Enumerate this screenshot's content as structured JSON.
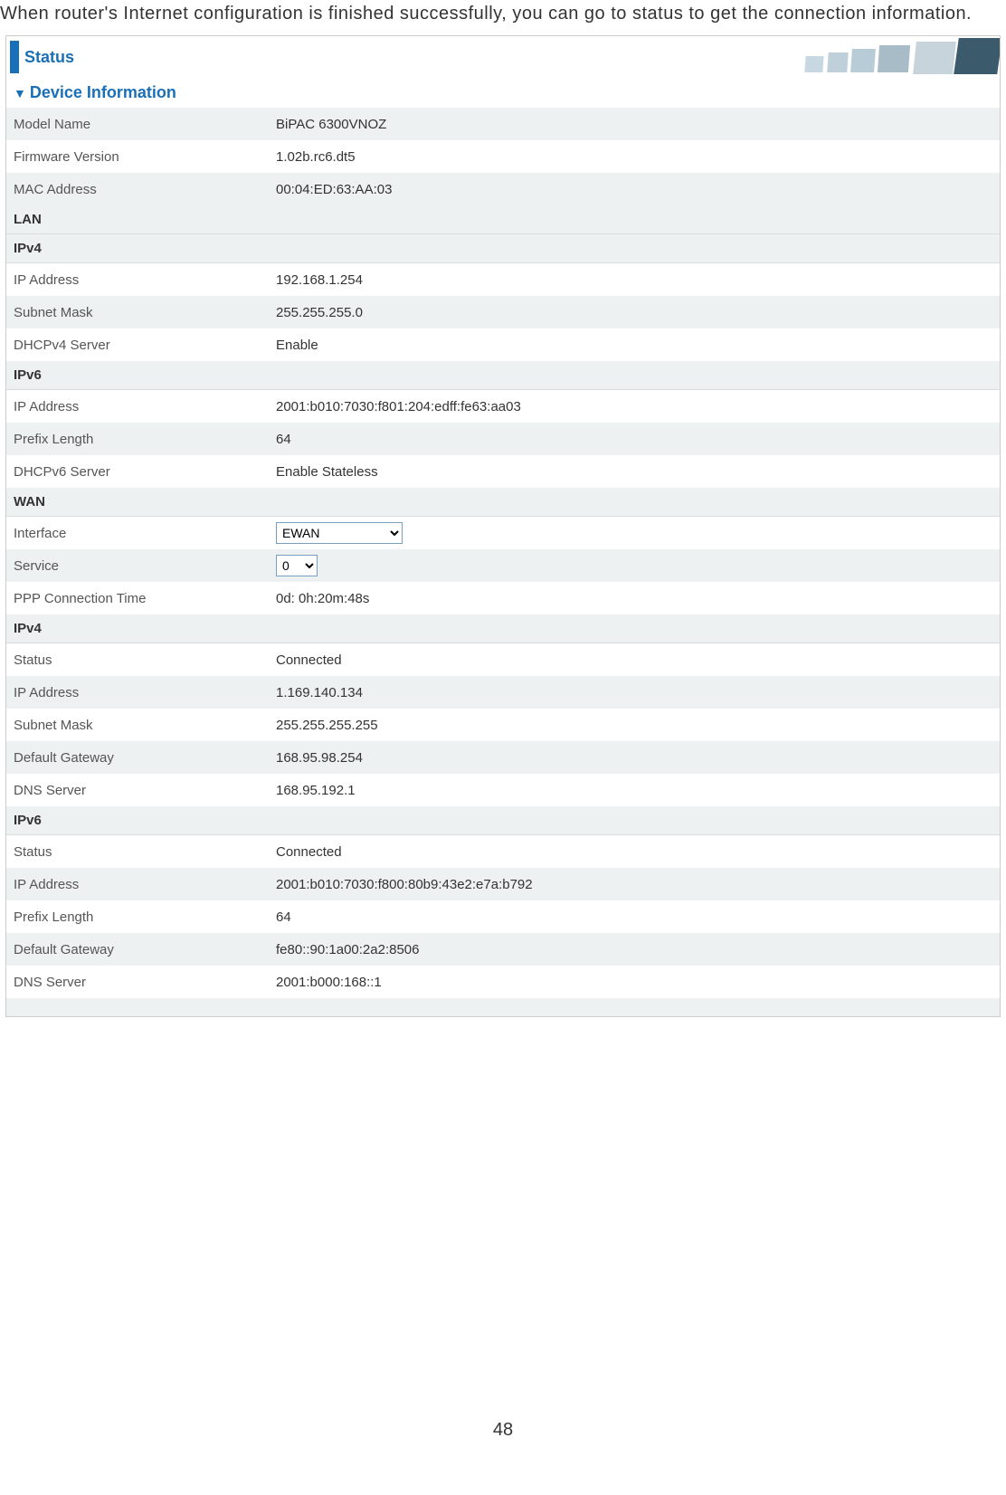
{
  "intro": "When router's Internet configuration is finished successfully, you can go to status to get the connection information.",
  "status_title": "Status",
  "section_title": "Device Information",
  "device": {
    "model_label": "Model Name",
    "model_value": "BiPAC 6300VNOZ",
    "firmware_label": "Firmware Version",
    "firmware_value": "1.02b.rc6.dt5",
    "mac_label": "MAC Address",
    "mac_value": "00:04:ED:63:AA:03"
  },
  "lan": {
    "header": "LAN",
    "ipv4_header": "IPv4",
    "ipv4": {
      "ip_label": "IP Address",
      "ip_value": "192.168.1.254",
      "subnet_label": "Subnet Mask",
      "subnet_value": "255.255.255.0",
      "dhcp_label": "DHCPv4 Server",
      "dhcp_value": "Enable"
    },
    "ipv6_header": "IPv6",
    "ipv6": {
      "ip_label": "IP Address",
      "ip_value": "2001:b010:7030:f801:204:edff:fe63:aa03",
      "prefix_label": "Prefix Length",
      "prefix_value": "64",
      "dhcp_label": "DHCPv6 Server",
      "dhcp_value": "Enable    Stateless"
    }
  },
  "wan": {
    "header": "WAN",
    "interface_label": "Interface",
    "interface_value": "EWAN",
    "service_label": "Service",
    "service_value": "0",
    "ppp_label": "PPP Connection Time",
    "ppp_value": "0d: 0h:20m:48s",
    "ipv4_header": "IPv4",
    "ipv4": {
      "status_label": "Status",
      "status_value": "Connected",
      "ip_label": "IP Address",
      "ip_value": "1.169.140.134",
      "subnet_label": "Subnet Mask",
      "subnet_value": "255.255.255.255",
      "gateway_label": "Default Gateway",
      "gateway_value": "168.95.98.254",
      "dns_label": "DNS Server",
      "dns_value": "168.95.192.1"
    },
    "ipv6_header": "IPv6",
    "ipv6": {
      "status_label": "Status",
      "status_value": "Connected",
      "ip_label": "IP Address",
      "ip_value": "2001:b010:7030:f800:80b9:43e2:e7a:b792",
      "prefix_label": "Prefix Length",
      "prefix_value": "64",
      "gateway_label": "Default Gateway",
      "gateway_value": "fe80::90:1a00:2a2:8506",
      "dns_label": "DNS Server",
      "dns_value": "2001:b000:168::1"
    }
  },
  "page_number": "48"
}
